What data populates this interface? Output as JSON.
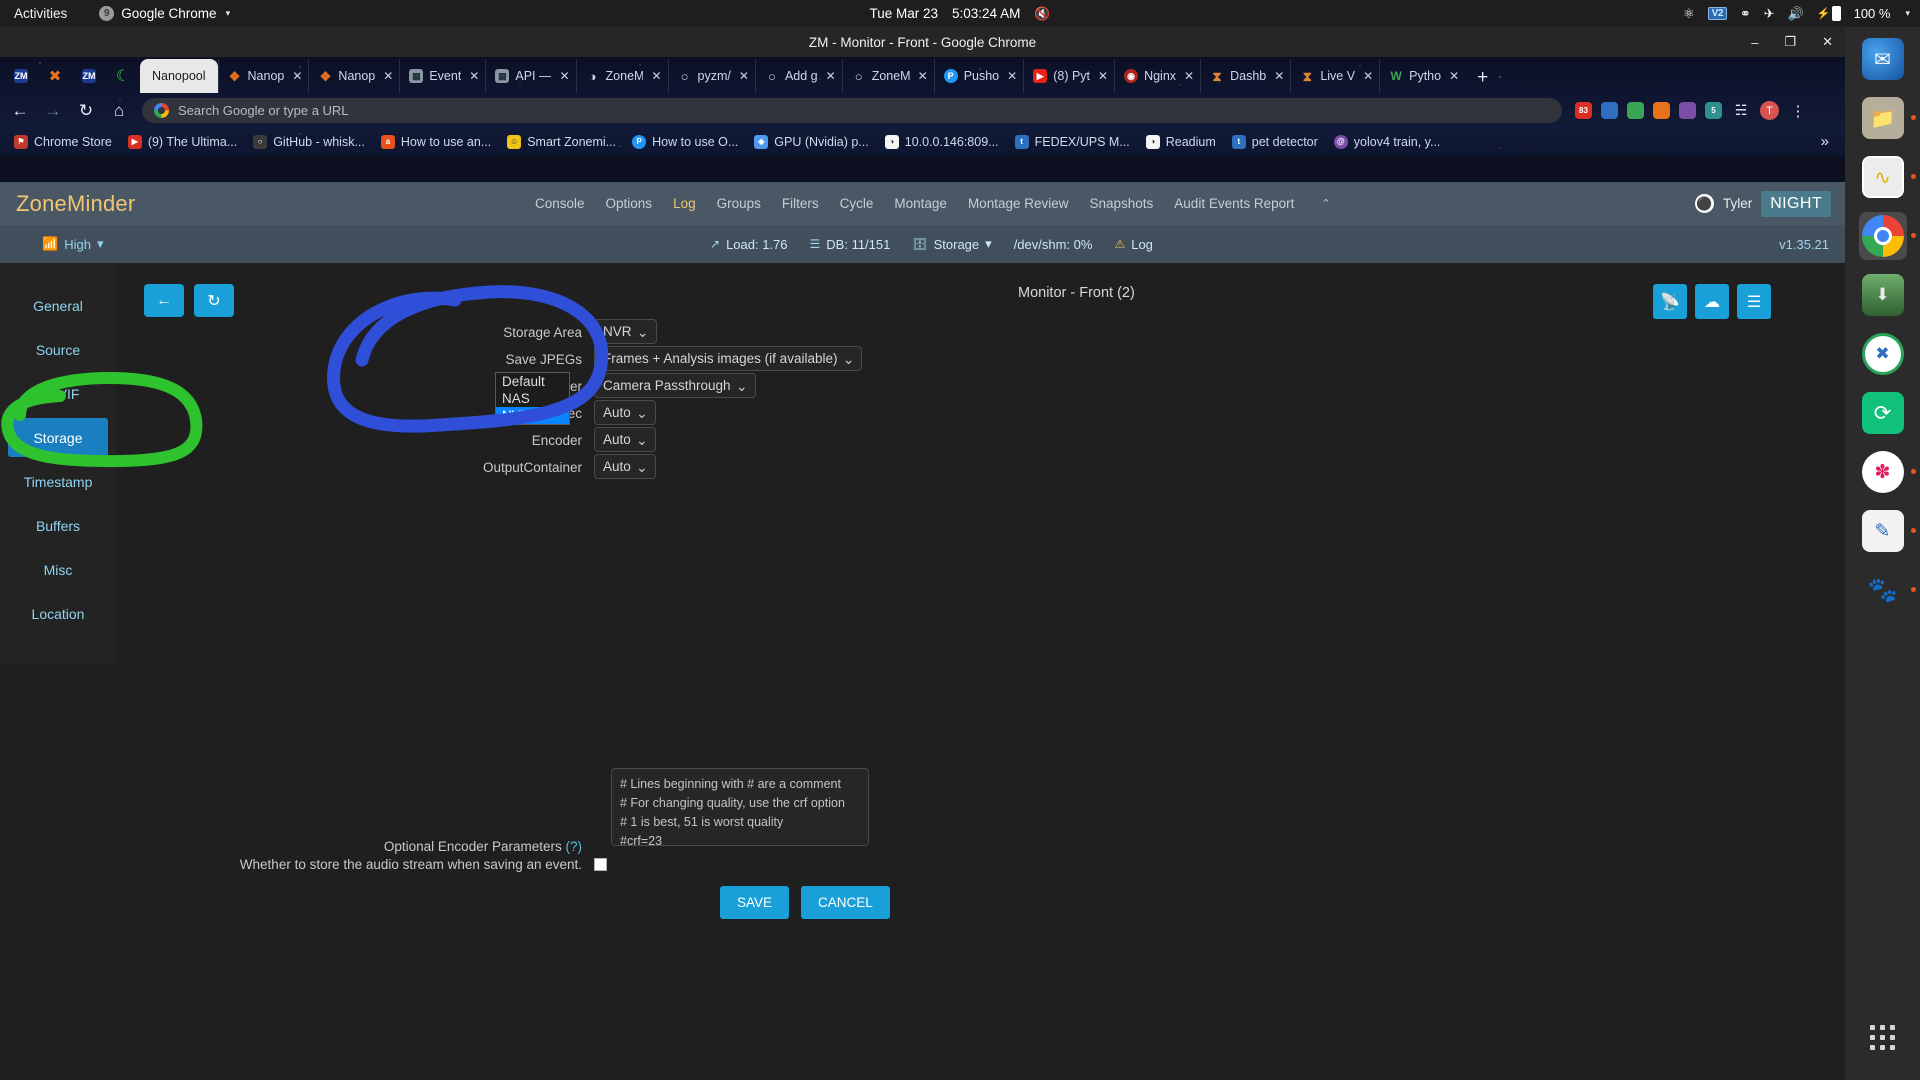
{
  "gnome": {
    "activities": "Activities",
    "app_name": "Google Chrome",
    "app_icon": "chrome-icon",
    "clock": "Tue Mar 23",
    "time": "5:03:24 AM",
    "mic_icon": "microphone-muted-icon",
    "tray": [
      {
        "name": "system-tray-icon",
        "glyph": "⚛"
      },
      {
        "name": "v2-indicator-icon",
        "glyph": "V2"
      },
      {
        "name": "network-wired-icon",
        "glyph": "⛭"
      },
      {
        "name": "airplane-mode-icon",
        "glyph": "✈"
      },
      {
        "name": "volume-icon",
        "glyph": "🔊"
      }
    ],
    "battery": "100 %",
    "battery_icon": "battery-charging-icon",
    "menu_caret": "▾"
  },
  "chrome": {
    "window_title": "ZM - Monitor - Front - Google Chrome",
    "window_buttons": {
      "minimize": "–",
      "maximize": "❐",
      "close": "✕"
    },
    "pinned_tabs": [
      {
        "name": "pinned-tab-zm-1",
        "icon": "zm-icon",
        "label": "ZM",
        "color": "#1f3a93"
      },
      {
        "name": "pinned-tab-x",
        "icon": "x-icon",
        "label": "✕",
        "color": "transparent"
      },
      {
        "name": "pinned-tab-zm-2",
        "icon": "zm-icon",
        "label": "ZM",
        "color": "#1f3a93"
      },
      {
        "name": "pinned-tab-moon",
        "icon": "moon-icon",
        "label": "☽",
        "color": "transparent"
      }
    ],
    "tabs": [
      {
        "label": "Nanopool",
        "icon_color": "#bdbdbd",
        "icon_char": "",
        "active": true,
        "close": "✕"
      },
      {
        "label": "Nanop",
        "icon_color": "#e8721c",
        "icon_char": "❖",
        "active": false,
        "close": "✕"
      },
      {
        "label": "Nanop",
        "icon_color": "#e8721c",
        "icon_char": "❖",
        "active": false,
        "close": "✕"
      },
      {
        "label": "Event",
        "icon_color": "#7a8a99",
        "icon_char": "☰",
        "active": false,
        "close": "✕"
      },
      {
        "label": "API —",
        "icon_color": "#7a8a99",
        "icon_char": "☰",
        "active": false,
        "close": "✕"
      },
      {
        "label": "ZoneM",
        "icon_color": "#6b7280",
        "icon_char": "◑",
        "active": false,
        "close": "✕"
      },
      {
        "label": "pyzm/",
        "icon_color": "#2a2a2a",
        "icon_char": "○",
        "active": false,
        "close": "✕"
      },
      {
        "label": "Add g",
        "icon_color": "#2a2a2a",
        "icon_char": "○",
        "active": false,
        "close": "✕"
      },
      {
        "label": "ZoneM",
        "icon_color": "#2a2a2a",
        "icon_char": "○",
        "active": false,
        "close": "✕"
      },
      {
        "label": "Pusho",
        "icon_color": "#2196f3",
        "icon_char": "P",
        "active": false,
        "close": "✕"
      },
      {
        "label": "(8) Pyt",
        "icon_color": "#e62117",
        "icon_char": "▶",
        "active": false,
        "close": "✕"
      },
      {
        "label": "Nginx",
        "icon_color": "#b0251a",
        "icon_char": "◉",
        "active": false,
        "close": "✕"
      },
      {
        "label": "Dashb",
        "icon_color": "#c96b1e",
        "icon_char": "⧗",
        "active": false,
        "close": "✕"
      },
      {
        "label": "Live V",
        "icon_color": "#c96b1e",
        "icon_char": "⧗",
        "active": false,
        "close": "✕"
      },
      {
        "label": "Pytho",
        "icon_color": "#3aa655",
        "icon_char": "W",
        "active": false,
        "close": "✕"
      }
    ],
    "new_tab": "+",
    "nav": {
      "back": "←",
      "forward": "→",
      "reload": "↻",
      "home": "⌂"
    },
    "omnibox": {
      "placeholder": "Search Google or type a URL",
      "value": "",
      "icon": "google-g-icon"
    },
    "toolbar_right": [
      {
        "name": "extension-count-icon",
        "label": "83",
        "color": "#d93025"
      },
      {
        "name": "extension-blue-icon",
        "label": "",
        "color": "#2f6fbf"
      },
      {
        "name": "extension-green-icon",
        "label": "",
        "color": "#3aa655"
      },
      {
        "name": "extension-orange-icon",
        "label": "",
        "color": "#e8721c"
      },
      {
        "name": "extension-purple-icon",
        "label": "",
        "color": "#7b4fa8"
      },
      {
        "name": "extension-teal-icon",
        "label": "5",
        "color": "#2f8f8f"
      },
      {
        "name": "extensions-puzzle-icon",
        "label": "⬚",
        "color": "transparent"
      }
    ],
    "profile_initial": "T",
    "menu_icon": "⋮",
    "bookmarks": [
      {
        "label": "Chrome Store",
        "color": "#c0392b",
        "char": "⚑"
      },
      {
        "label": "(9) The Ultima...",
        "color": "#d93025",
        "char": "▶"
      },
      {
        "label": "GitHub - whisk...",
        "color": "#3a3a3a",
        "char": "○"
      },
      {
        "label": "How to use an...",
        "color": "#e8511c",
        "char": "a"
      },
      {
        "label": "Smart Zonemi...",
        "color": "#f0c419",
        "char": "☺"
      },
      {
        "label": "How to use O...",
        "color": "#2196f3",
        "char": "P"
      },
      {
        "label": "GPU (Nvidia) p...",
        "color": "#4e9af1",
        "char": "◈"
      },
      {
        "label": "10.0.0.146:809...",
        "color": "#f5f5f5",
        "char": "◑"
      },
      {
        "label": "FEDEX/UPS M...",
        "color": "#2f6fbf",
        "char": "t"
      },
      {
        "label": "Readium",
        "color": "#f5f5f5",
        "char": "◑"
      },
      {
        "label": "pet detector",
        "color": "#2f6fbf",
        "char": "t"
      },
      {
        "label": "yolov4 train, y...",
        "color": "#7b4fa8",
        "char": "@"
      }
    ],
    "bookmarks_overflow": "»"
  },
  "zoneminder": {
    "logo": "ZoneMinder",
    "nav": [
      {
        "label": "Console",
        "active": false
      },
      {
        "label": "Options",
        "active": false
      },
      {
        "label": "Log",
        "active": true
      },
      {
        "label": "Groups",
        "active": false
      },
      {
        "label": "Filters",
        "active": false
      },
      {
        "label": "Cycle",
        "active": false
      },
      {
        "label": "Montage",
        "active": false
      },
      {
        "label": "Montage Review",
        "active": false
      },
      {
        "label": "Snapshots",
        "active": false
      },
      {
        "label": "Audit Events Report",
        "active": false
      }
    ],
    "nav_collapse_icon": "⌃",
    "user": "Tyler",
    "user_icon": "user-avatar-icon",
    "night_badge": "NIGHT",
    "bandwidth": "High",
    "bandwidth_icon": "wifi-icon",
    "bandwidth_caret": "▾",
    "stats": [
      {
        "name": "load-stat",
        "icon": "trend-up-icon",
        "label": "Load: 1.76"
      },
      {
        "name": "db-stat",
        "icon": "database-icon",
        "label": "DB: 11/151"
      },
      {
        "name": "storage-stat",
        "icon": "storage-icon",
        "label": "Storage",
        "caret": "▾"
      },
      {
        "name": "shm-stat",
        "icon": "",
        "label": "/dev/shm: 0%"
      },
      {
        "name": "log-stat",
        "icon": "warning-icon",
        "label": "Log"
      }
    ],
    "version": "v1.35.21",
    "sidebar": [
      {
        "label": "General",
        "active": false
      },
      {
        "label": "Source",
        "active": false
      },
      {
        "label": "ONVIF",
        "active": false
      },
      {
        "label": "Storage",
        "active": true
      },
      {
        "label": "Timestamp",
        "active": false
      },
      {
        "label": "Buffers",
        "active": false
      },
      {
        "label": "Misc",
        "active": false
      },
      {
        "label": "Location",
        "active": false
      }
    ],
    "back_icon": "←",
    "refresh_icon": "↻",
    "monitor_title": "Monitor - Front (2)",
    "right_buttons": [
      {
        "name": "rss-feed-button",
        "icon": "὏6"
      },
      {
        "name": "rss-button",
        "icon": "ಠ"
      },
      {
        "name": "list-view-button",
        "icon": "☰"
      }
    ],
    "form": {
      "storage_area": {
        "label": "Storage Area",
        "value": "NVR"
      },
      "save_jpegs": {
        "label": "Save JPEGs",
        "value": "Frames + Analysis images (if available)"
      },
      "video_writer": {
        "label": "Video Writer",
        "value": "Camera Passthrough"
      },
      "output_codec": {
        "label": "OutputCodec",
        "value": "Auto"
      },
      "encoder": {
        "label": "Encoder",
        "value": "Auto"
      },
      "output_container": {
        "label": "OutputContainer",
        "value": "Auto"
      },
      "encoder_params_label": "Optional Encoder Parameters",
      "encoder_params_help": "(?)",
      "encoder_params_value": "# Lines beginning with # are a comment\n# For changing quality, use the crf option\n# 1 is best, 51 is worst quality\n#crf=23",
      "audio_label": "Whether to store the audio stream when saving an event.",
      "audio_checked": false,
      "save_button": "SAVE",
      "cancel_button": "CANCEL"
    },
    "dropdown": {
      "open": true,
      "options": [
        "Default",
        "NAS",
        "NVR"
      ],
      "selected": "NVR"
    }
  },
  "dock": [
    {
      "name": "dock-thunderbird",
      "icon": "thunderbird-icon",
      "color": "#1a6fc4",
      "char": "✉",
      "running": false,
      "selected": false
    },
    {
      "name": "dock-files",
      "icon": "files-folder-icon",
      "color": "#b5ae9b",
      "char": "▭",
      "running": true,
      "selected": false
    },
    {
      "name": "dock-system-monitor",
      "icon": "system-monitor-icon",
      "color": "#e8e8e8",
      "char": "⌇",
      "running": true,
      "selected": false
    },
    {
      "name": "dock-chrome",
      "icon": "chrome-icon",
      "color": "#ffffff",
      "char": "◯",
      "running": true,
      "selected": true
    },
    {
      "name": "dock-terminal-download",
      "icon": "terminal-download-icon",
      "color": "#4a7a4a",
      "char": "⬇",
      "running": false,
      "selected": false
    },
    {
      "name": "dock-remmina",
      "icon": "remmina-icon",
      "color": "#ffffff",
      "char": "✕",
      "running": false,
      "selected": false
    },
    {
      "name": "dock-sync",
      "icon": "sync-icon",
      "color": "#11c07a",
      "char": "↻",
      "running": false,
      "selected": false
    },
    {
      "name": "dock-slack",
      "icon": "slack-icon",
      "color": "#ffffff",
      "char": "✽",
      "running": true,
      "selected": false
    },
    {
      "name": "dock-text-editor",
      "icon": "text-editor-icon",
      "color": "#f0f0f0",
      "char": "✎",
      "running": true,
      "selected": false
    },
    {
      "name": "dock-gimp",
      "icon": "gimp-icon",
      "color": "#3a3a3a",
      "char": "◕",
      "running": true,
      "selected": false
    }
  ],
  "annotations": {
    "blue_circle_color": "#2f4fd8",
    "green_circle_color": "#2fc22f"
  }
}
